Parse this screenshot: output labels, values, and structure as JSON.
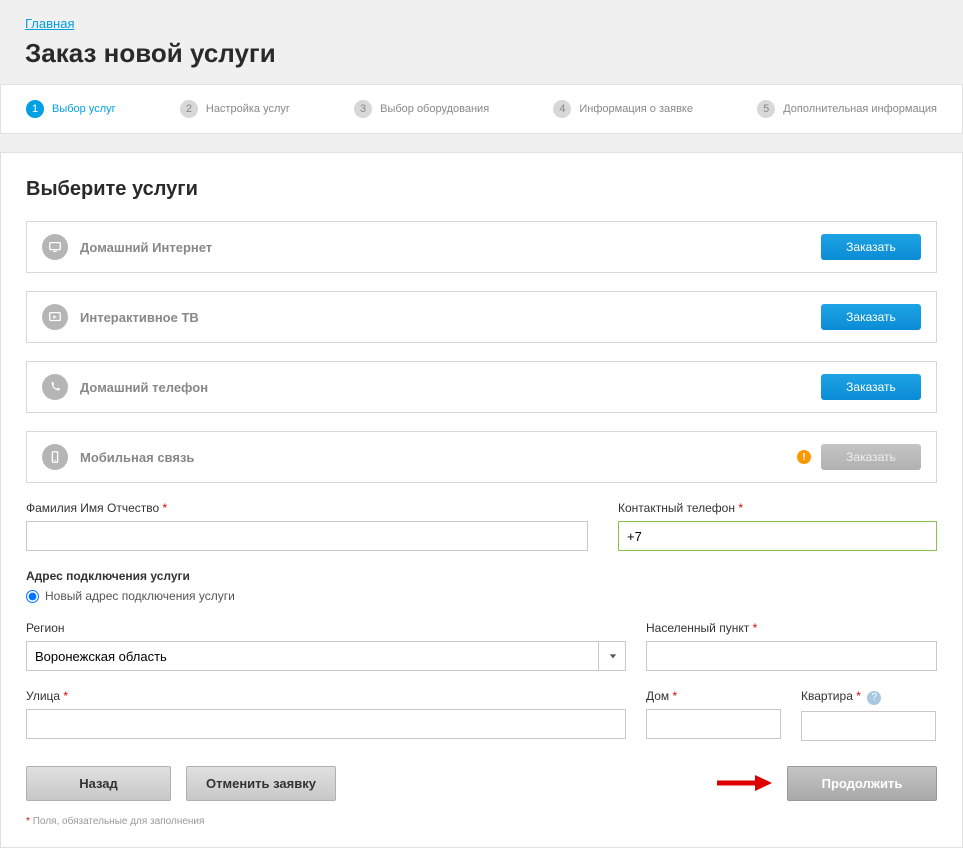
{
  "header": {
    "breadcrumb": "Главная",
    "title": "Заказ новой услуги"
  },
  "stepper": {
    "steps": [
      {
        "num": "1",
        "label": "Выбор услуг",
        "active": true
      },
      {
        "num": "2",
        "label": "Настройка услуг",
        "active": false
      },
      {
        "num": "3",
        "label": "Выбор оборудования",
        "active": false
      },
      {
        "num": "4",
        "label": "Информация о заявке",
        "active": false
      },
      {
        "num": "5",
        "label": "Дополнительная информация",
        "active": false
      }
    ]
  },
  "section_title": "Выберите услуги",
  "services": [
    {
      "name": "Домашний Интернет",
      "order_label": "Заказать",
      "enabled": true,
      "icon": "monitor"
    },
    {
      "name": "Интерактивное ТВ",
      "order_label": "Заказать",
      "enabled": true,
      "icon": "tv"
    },
    {
      "name": "Домашний телефон",
      "order_label": "Заказать",
      "enabled": true,
      "icon": "phone"
    },
    {
      "name": "Мобильная связь",
      "order_label": "Заказать",
      "enabled": false,
      "icon": "mobile",
      "warning": true
    }
  ],
  "form": {
    "fio_label": "Фамилия Имя Отчество",
    "fio_value": "",
    "phone_label": "Контактный телефон",
    "phone_value": "+7",
    "address_section_label": "Адрес подключения услуги",
    "address_radio_label": "Новый адрес подключения услуги",
    "region_label": "Регион",
    "region_value": "Воронежская область",
    "city_label": "Населенный пункт",
    "city_value": "",
    "street_label": "Улица",
    "street_value": "",
    "house_label": "Дом",
    "house_value": "",
    "apt_label": "Квартира",
    "apt_value": ""
  },
  "buttons": {
    "back": "Назад",
    "cancel": "Отменить заявку",
    "continue": "Продолжить"
  },
  "footnote": "Поля, обязательные для заполнения"
}
